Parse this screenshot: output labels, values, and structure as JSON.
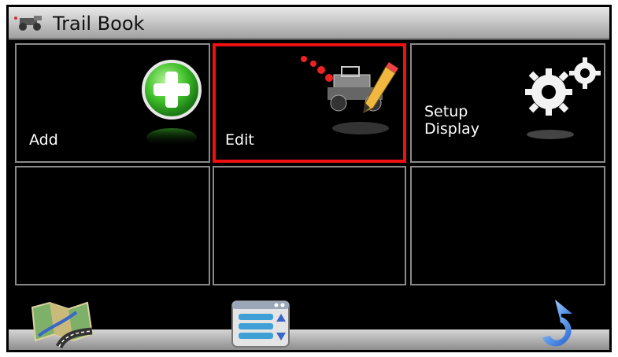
{
  "header": {
    "title": "Trail Book",
    "icon": "jeep-icon"
  },
  "tiles": [
    {
      "label": "Add",
      "icon": "plus-icon",
      "selected": false
    },
    {
      "label": "Edit",
      "icon": "edit-jeep-icon",
      "selected": true
    },
    {
      "label_line1": "Setup",
      "label_line2": "Display",
      "icon": "gears-icon",
      "selected": false
    },
    {
      "label": ""
    },
    {
      "label": ""
    },
    {
      "label": ""
    }
  ],
  "bottom": {
    "left_icon": "map-icon",
    "center_icon": "list-menu-icon",
    "right_icon": "back-arrow-icon"
  },
  "colors": {
    "selection_border": "#ee1111",
    "accent_green": "#3fbf2a",
    "accent_blue": "#2b7fe0"
  }
}
